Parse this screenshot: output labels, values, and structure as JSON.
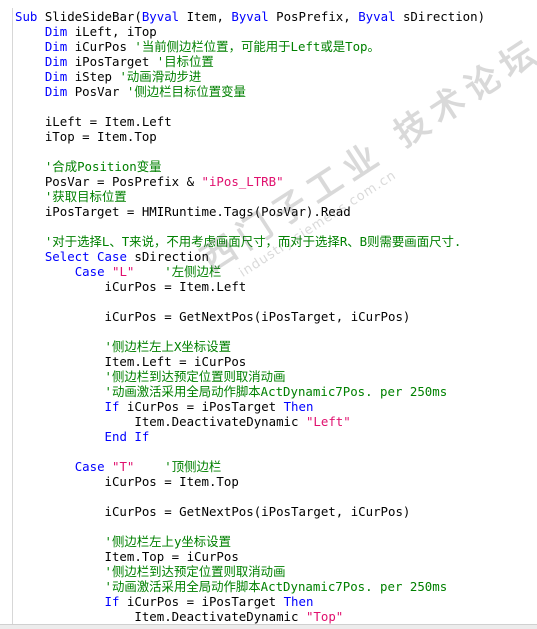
{
  "watermark": {
    "chinese_text": "西门子工业 技术论坛",
    "url_text": "industry.siemens.com.cn"
  },
  "code_lines": [
    [
      {
        "t": "Sub ",
        "c": "kw"
      },
      {
        "t": "SlideSideBar(",
        "c": "tx"
      },
      {
        "t": "Byval",
        "c": "kw"
      },
      {
        "t": " Item, ",
        "c": "tx"
      },
      {
        "t": "Byval",
        "c": "kw"
      },
      {
        "t": " PosPrefix, ",
        "c": "tx"
      },
      {
        "t": "Byval",
        "c": "kw"
      },
      {
        "t": " sDirection)",
        "c": "tx"
      }
    ],
    [
      {
        "t": "    ",
        "c": "tx"
      },
      {
        "t": "Dim",
        "c": "kw"
      },
      {
        "t": " iLeft, iTop",
        "c": "tx"
      }
    ],
    [
      {
        "t": "    ",
        "c": "tx"
      },
      {
        "t": "Dim",
        "c": "kw"
      },
      {
        "t": " iCurPos ",
        "c": "tx"
      },
      {
        "t": "'当前侧边栏位置，可能用于Left或是Top。",
        "c": "cm"
      }
    ],
    [
      {
        "t": "    ",
        "c": "tx"
      },
      {
        "t": "Dim",
        "c": "kw"
      },
      {
        "t": " iPosTarget ",
        "c": "tx"
      },
      {
        "t": "'目标位置",
        "c": "cm"
      }
    ],
    [
      {
        "t": "    ",
        "c": "tx"
      },
      {
        "t": "Dim",
        "c": "kw"
      },
      {
        "t": " iStep ",
        "c": "tx"
      },
      {
        "t": "'动画滑动步进",
        "c": "cm"
      }
    ],
    [
      {
        "t": "    ",
        "c": "tx"
      },
      {
        "t": "Dim",
        "c": "kw"
      },
      {
        "t": " PosVar ",
        "c": "tx"
      },
      {
        "t": "'侧边栏目标位置变量",
        "c": "cm"
      }
    ],
    [],
    [
      {
        "t": "    iLeft = Item.Left",
        "c": "tx"
      }
    ],
    [
      {
        "t": "    iTop = Item.Top",
        "c": "tx"
      }
    ],
    [],
    [
      {
        "t": "    ",
        "c": "tx"
      },
      {
        "t": "'合成Position变量",
        "c": "cm"
      }
    ],
    [
      {
        "t": "    PosVar = PosPrefix & ",
        "c": "tx"
      },
      {
        "t": "\"iPos_LTRB\"",
        "c": "str"
      }
    ],
    [
      {
        "t": "    ",
        "c": "tx"
      },
      {
        "t": "'获取目标位置",
        "c": "cm"
      }
    ],
    [
      {
        "t": "    iPosTarget = HMIRuntime.Tags(PosVar).Read",
        "c": "tx"
      }
    ],
    [],
    [
      {
        "t": "    ",
        "c": "tx"
      },
      {
        "t": "'对于选择L、T来说，不用考虑画面尺寸，而对于选择R、B则需要画面尺寸.",
        "c": "cm"
      }
    ],
    [
      {
        "t": "    ",
        "c": "tx"
      },
      {
        "t": "Select Case",
        "c": "kw"
      },
      {
        "t": " sDirection",
        "c": "tx"
      }
    ],
    [
      {
        "t": "        ",
        "c": "tx"
      },
      {
        "t": "Case",
        "c": "kw"
      },
      {
        "t": " ",
        "c": "tx"
      },
      {
        "t": "\"L\"",
        "c": "str"
      },
      {
        "t": "    ",
        "c": "tx"
      },
      {
        "t": "'左侧边栏",
        "c": "cm"
      }
    ],
    [
      {
        "t": "            iCurPos = Item.Left",
        "c": "tx"
      }
    ],
    [],
    [
      {
        "t": "            iCurPos = GetNextPos(iPosTarget, iCurPos)",
        "c": "tx"
      }
    ],
    [],
    [
      {
        "t": "            ",
        "c": "tx"
      },
      {
        "t": "'侧边栏左上X坐标设置",
        "c": "cm"
      }
    ],
    [
      {
        "t": "            Item.Left = iCurPos",
        "c": "tx"
      }
    ],
    [
      {
        "t": "            ",
        "c": "tx"
      },
      {
        "t": "'侧边栏到达预定位置则取消动画",
        "c": "cm"
      }
    ],
    [
      {
        "t": "            ",
        "c": "tx"
      },
      {
        "t": "'动画激活采用全局动作脚本ActDynamic7Pos. per 250ms",
        "c": "cm"
      }
    ],
    [
      {
        "t": "            ",
        "c": "tx"
      },
      {
        "t": "If",
        "c": "kw"
      },
      {
        "t": " iCurPos = iPosTarget ",
        "c": "tx"
      },
      {
        "t": "Then",
        "c": "kw"
      }
    ],
    [
      {
        "t": "                Item.DeactivateDynamic ",
        "c": "tx"
      },
      {
        "t": "\"Left\"",
        "c": "str"
      }
    ],
    [
      {
        "t": "            ",
        "c": "tx"
      },
      {
        "t": "End If",
        "c": "kw"
      }
    ],
    [],
    [
      {
        "t": "        ",
        "c": "tx"
      },
      {
        "t": "Case",
        "c": "kw"
      },
      {
        "t": " ",
        "c": "tx"
      },
      {
        "t": "\"T\"",
        "c": "str"
      },
      {
        "t": "    ",
        "c": "tx"
      },
      {
        "t": "'顶侧边栏",
        "c": "cm"
      }
    ],
    [
      {
        "t": "            iCurPos = Item.Top",
        "c": "tx"
      }
    ],
    [],
    [
      {
        "t": "            iCurPos = GetNextPos(iPosTarget, iCurPos)",
        "c": "tx"
      }
    ],
    [],
    [
      {
        "t": "            ",
        "c": "tx"
      },
      {
        "t": "'侧边栏左上y坐标设置",
        "c": "cm"
      }
    ],
    [
      {
        "t": "            Item.Top = iCurPos",
        "c": "tx"
      }
    ],
    [
      {
        "t": "            ",
        "c": "tx"
      },
      {
        "t": "'侧边栏到达预定位置则取消动画",
        "c": "cm"
      }
    ],
    [
      {
        "t": "            ",
        "c": "tx"
      },
      {
        "t": "'动画激活采用全局动作脚本ActDynamic7Pos. per 250ms",
        "c": "cm"
      }
    ],
    [
      {
        "t": "            ",
        "c": "tx"
      },
      {
        "t": "If",
        "c": "kw"
      },
      {
        "t": " iCurPos = iPosTarget ",
        "c": "tx"
      },
      {
        "t": "Then",
        "c": "kw"
      }
    ],
    [
      {
        "t": "                Item.DeactivateDynamic ",
        "c": "tx"
      },
      {
        "t": "\"Top\"",
        "c": "str"
      }
    ]
  ]
}
